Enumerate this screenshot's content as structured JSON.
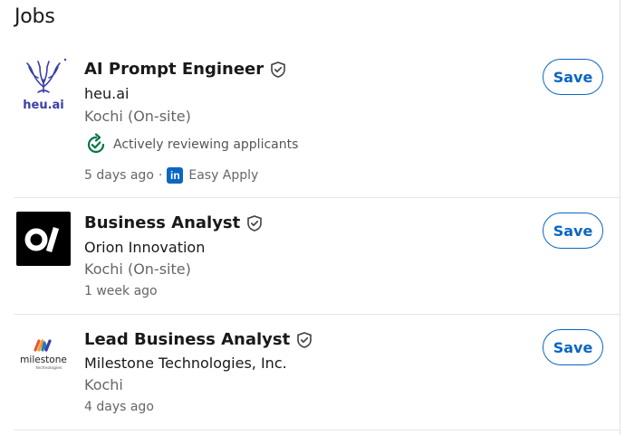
{
  "section": {
    "title": "Jobs"
  },
  "jobs": [
    {
      "title": "AI Prompt Engineer",
      "company": "heu.ai",
      "location": "Kochi (On-site)",
      "insight": "Actively reviewing applicants",
      "posted": "5 days ago",
      "separator": "·",
      "apply_badge": "in",
      "apply_label": "Easy Apply",
      "logo_text": "heu.ai",
      "save_label": "Save"
    },
    {
      "title": "Business Analyst",
      "company": "Orion Innovation",
      "location": "Kochi (On-site)",
      "posted": "1 week ago",
      "save_label": "Save"
    },
    {
      "title": "Lead Business Analyst",
      "company": "Milestone Technologies, Inc.",
      "location": "Kochi",
      "posted": "4 days ago",
      "logo_text": "milestone",
      "logo_subtext": "technologies",
      "save_label": "Save"
    }
  ],
  "colors": {
    "accent": "#0a66c2",
    "insight_green": "#057642",
    "heu_blue": "#3a3fa8"
  }
}
